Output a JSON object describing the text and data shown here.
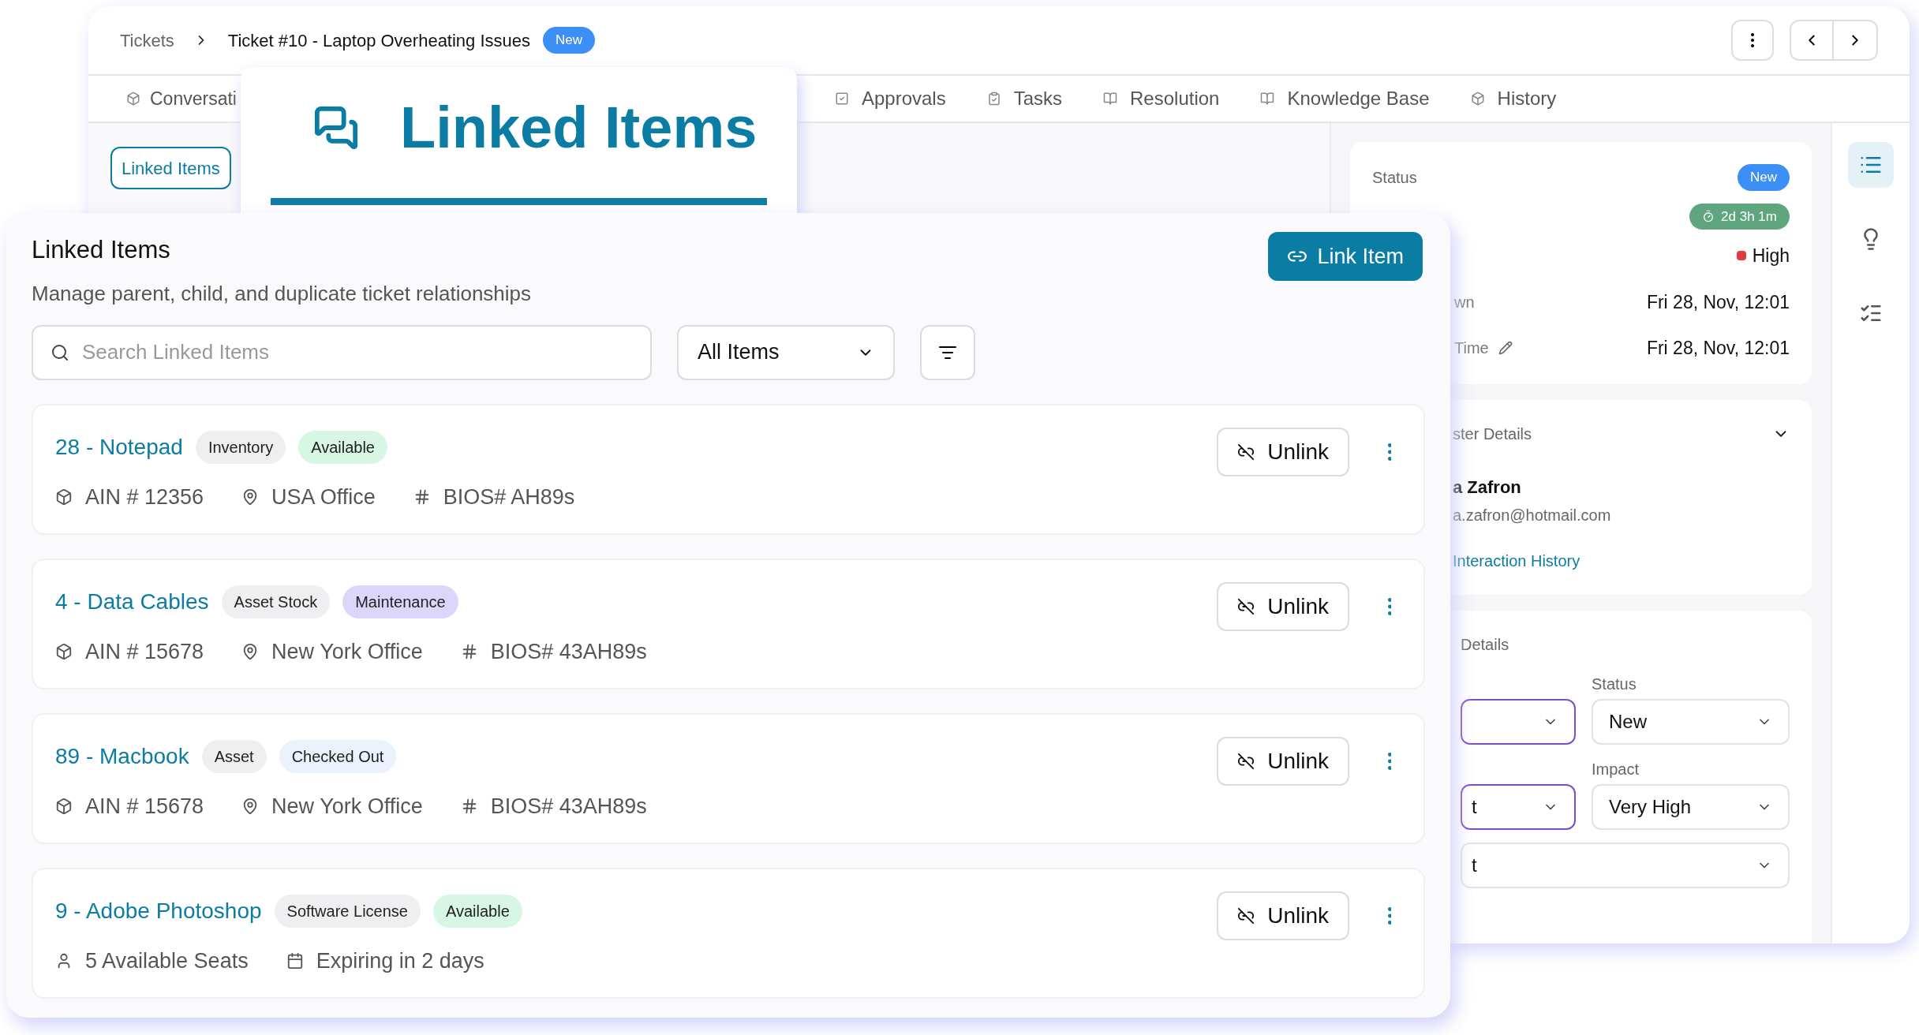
{
  "header": {
    "breadcrumb": "Tickets",
    "title": "Ticket #10 - Laptop Overheating Issues",
    "status_badge": "New"
  },
  "tabs": [
    {
      "label": "Conversati",
      "selected": false
    },
    {
      "label": "Approvals",
      "selected": false
    },
    {
      "label": "Tasks",
      "selected": false
    },
    {
      "label": "Resolution",
      "selected": false
    },
    {
      "label": "Knowledge Base",
      "selected": false
    },
    {
      "label": "History",
      "selected": false
    }
  ],
  "subtab": {
    "label": "Linked Items",
    "selected": true
  },
  "callout": {
    "label": "Linked Items",
    "selected": true
  },
  "side_panel": {
    "status": {
      "label": "Status",
      "badge": "New",
      "timer": "2d 3h 1m",
      "priority": "High",
      "rows": [
        {
          "label": "wn",
          "value": "Fri 28, Nov, 12:01",
          "editable": false
        },
        {
          "label": "Time",
          "value": "Fri 28, Nov, 12:01",
          "editable": true
        }
      ]
    },
    "requester": {
      "title": "ster Details",
      "expanded": true,
      "name": "a Zafron",
      "email": "a.zafron@hotmail.com",
      "link": "Interaction History"
    },
    "details": {
      "title": "Details",
      "fields": [
        {
          "highlighted": true
        },
        {
          "label": "Status",
          "value": "New",
          "highlighted": false
        },
        {
          "value": "t",
          "highlighted": true
        },
        {
          "label": "Impact",
          "value": "Very High",
          "highlighted": false
        },
        {
          "value": "t",
          "highlighted": false,
          "wide": true
        }
      ]
    }
  },
  "rail": [
    {
      "selected": true
    },
    {
      "selected": false
    },
    {
      "selected": false
    }
  ],
  "linked": {
    "title": "Linked Items",
    "subtitle": "Manage parent, child, and duplicate ticket relationships",
    "search_placeholder": "Search Linked Items",
    "filter_value": "All Items",
    "link_button": "Link Item",
    "items": [
      {
        "title": "28 - Notepad",
        "tags": [
          {
            "label": "Inventory",
            "color": "#efeff1"
          },
          {
            "label": "Available",
            "color": "#d7f6e4"
          }
        ],
        "meta": [
          {
            "kind": "asset",
            "text": "AIN # 12356"
          },
          {
            "kind": "location",
            "text": "USA Office"
          },
          {
            "kind": "code",
            "text": "BIOS# AH89s"
          }
        ],
        "action": "Unlink"
      },
      {
        "title": "4 - Data Cables",
        "tags": [
          {
            "label": "Asset Stock",
            "color": "#efeff1"
          },
          {
            "label": "Maintenance",
            "color": "#ddd6fb"
          }
        ],
        "meta": [
          {
            "kind": "asset",
            "text": "AIN # 15678"
          },
          {
            "kind": "location",
            "text": "New York Office"
          },
          {
            "kind": "code",
            "text": "BIOS# 43AH89s"
          }
        ],
        "action": "Unlink"
      },
      {
        "title": "89 - Macbook",
        "tags": [
          {
            "label": "Asset",
            "color": "#efeff1"
          },
          {
            "label": "Checked Out",
            "color": "#ebf1fd"
          }
        ],
        "meta": [
          {
            "kind": "asset",
            "text": "AIN # 15678"
          },
          {
            "kind": "location",
            "text": "New York Office"
          },
          {
            "kind": "code",
            "text": "BIOS# 43AH89s"
          }
        ],
        "action": "Unlink"
      },
      {
        "title": "9 - Adobe Photoshop",
        "tags": [
          {
            "label": "Software License",
            "color": "#efeff1"
          },
          {
            "label": "Available",
            "color": "#d7f6e4"
          }
        ],
        "meta": [
          {
            "kind": "seats",
            "text": "5 Available Seats"
          },
          {
            "kind": "date",
            "text": "Expiring in 2 days"
          }
        ],
        "action": "Unlink"
      }
    ]
  }
}
